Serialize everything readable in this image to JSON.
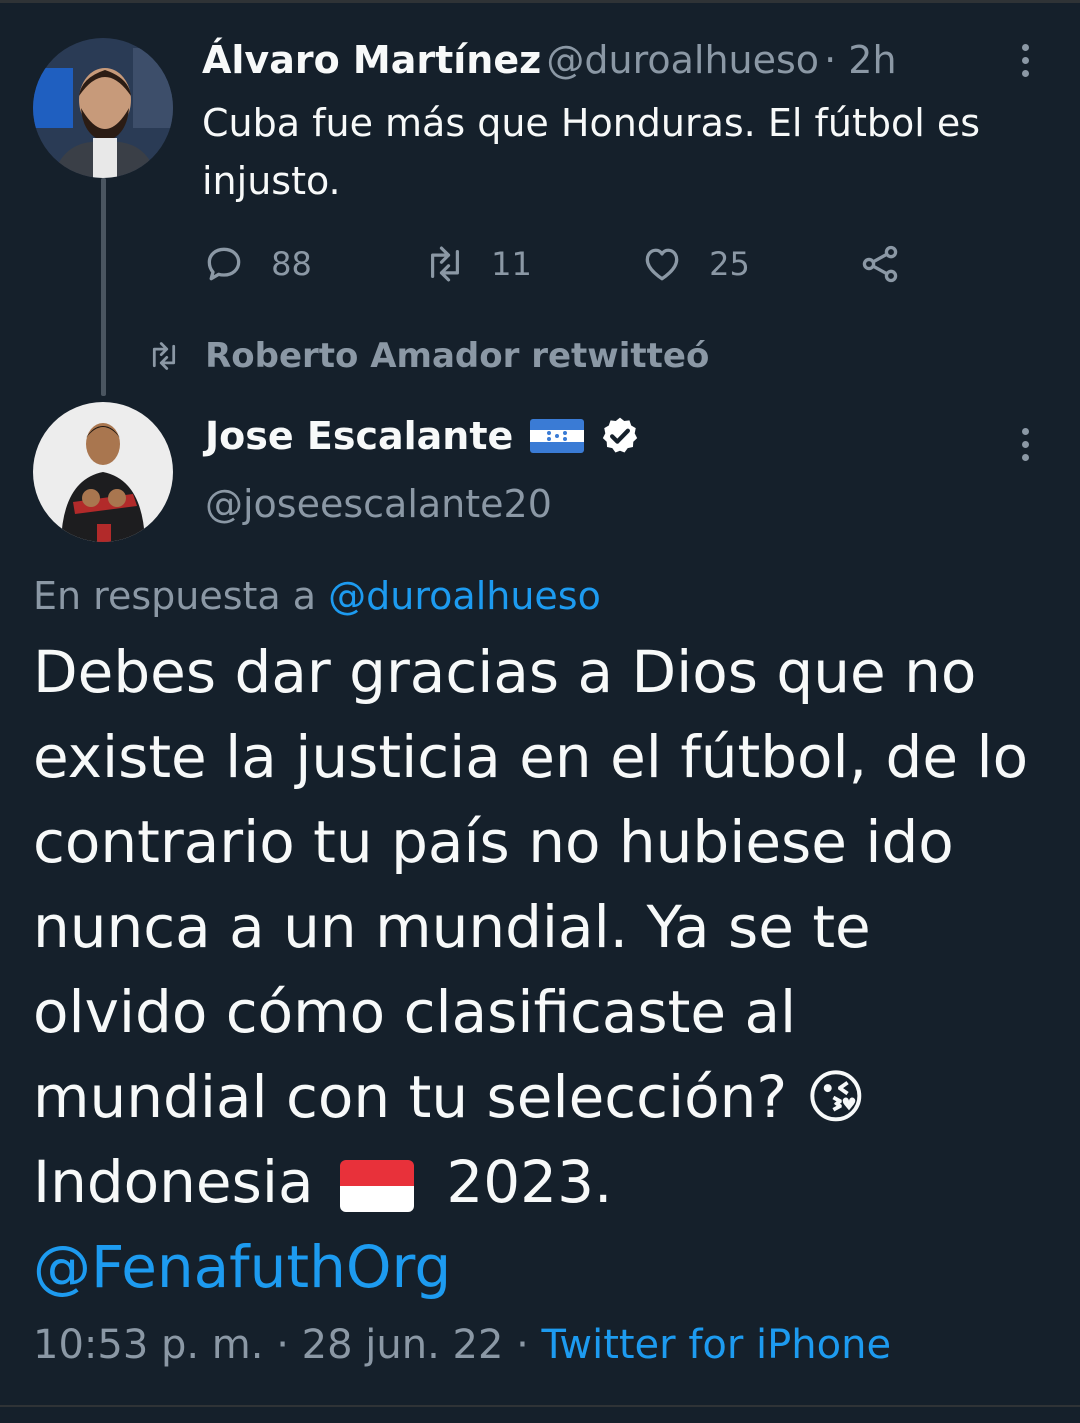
{
  "parent_tweet": {
    "author_name": "Álvaro Martínez",
    "handle": "@duroalhueso",
    "time": "· 2h",
    "text_line1": "Cuba fue más que Honduras. El fútbol es",
    "text_line2": "injusto.",
    "replies": "88",
    "retweets": "11",
    "likes": "25"
  },
  "retweet_banner": "Roberto Amador retwitteó",
  "main_tweet": {
    "author_name": "Jose Escalante",
    "handle": "@joseescalante20",
    "reply_prefix": "En respuesta a",
    "reply_to": "@duroalhueso",
    "lines": [
      "Debes dar gracias a Dios que no",
      "existe la justicia en el fútbol, de lo",
      "contrario tu país no hubiese ido",
      "nunca a un mundial. Ya se te",
      "olvido cómo clasificaste al",
      "mundial con tu selección? 😘"
    ],
    "line7_start": "Indonesia",
    "line7_end": "2023.",
    "mention": "@FenafuthOrg",
    "timestamp": "10:53 p. m. · 28 jun. 22 ·",
    "source": "Twitter for iPhone"
  },
  "icons": {
    "reply": "reply-icon",
    "retweet": "retweet-icon",
    "like": "heart-icon",
    "share": "share-icon",
    "more": "more-icon",
    "verified": "verified-badge-icon"
  }
}
